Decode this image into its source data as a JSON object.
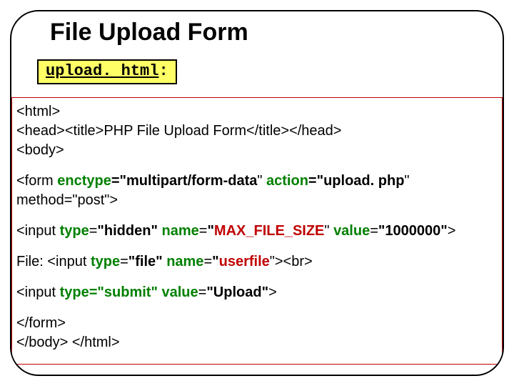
{
  "title": "File Upload Form",
  "filename": "upload. html",
  "filename_suffix": ":",
  "code": {
    "l1": "<html>",
    "l2": "<head><title>PHP File Upload Form</title></head>",
    "l3": "<body>",
    "form_open_a": "<form ",
    "form_kw1": "enctype",
    "form_eq1": "=\"",
    "form_val1": "multipart/form-data",
    "form_q1b": "\" ",
    "form_kw2": "action",
    "form_eq2": "=\"",
    "form_val2": "upload. php",
    "form_q2b": "\"",
    "form_line2a": "method=\"post\">",
    "hidden_a": "<input ",
    "hidden_kw1": "type",
    "hidden_eq1": "=",
    "hidden_val1": "\"hidden\" ",
    "hidden_kw2": "name",
    "hidden_eq2": "=",
    "hidden_val2_q": "\"",
    "hidden_val2": "MAX_FILE_SIZE",
    "hidden_val2_qb": "\"  ",
    "hidden_kw3": "value",
    "hidden_eq3": "=",
    "hidden_val3": "\"1000000\"",
    "hidden_end": ">",
    "file_a": "File: <input ",
    "file_kw1": "type",
    "file_eq1": "=",
    "file_val1": "\"file\" ",
    "file_kw2": "name",
    "file_eq2": "=",
    "file_val2_q": "\"",
    "file_val2": "userfile",
    "file_val2_qb": "\"",
    "file_end": "><br>",
    "submit_a": "<input ",
    "submit_kw1": "type=\"submit\" value",
    "submit_eq1": "=",
    "submit_val1": "\"Upload\"",
    "submit_end": ">",
    "close1": "</form>",
    "close2": "</body> </html>"
  }
}
